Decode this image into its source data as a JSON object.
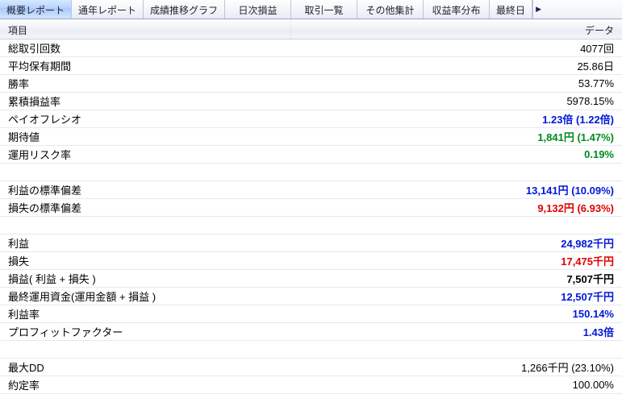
{
  "tabs": {
    "items": [
      "概要レポート",
      "通年レポート",
      "成績推移グラフ",
      "日次損益",
      "取引一覧",
      "その他集計",
      "収益率分布",
      "最終日"
    ],
    "active_index": 0
  },
  "header": {
    "left": "項目",
    "right": "データ"
  },
  "rows": [
    {
      "label": "総取引回数",
      "value": "4077回",
      "cls": ""
    },
    {
      "label": "平均保有期間",
      "value": "25.86日",
      "cls": ""
    },
    {
      "label": "勝率",
      "value": "53.77%",
      "cls": ""
    },
    {
      "label": "累積損益率",
      "value": "5978.15%",
      "cls": ""
    },
    {
      "label": "ペイオフレシオ",
      "value": "1.23倍 (1.22倍)",
      "cls": "blue"
    },
    {
      "label": "期待値",
      "value": "1,841円 (1.47%)",
      "cls": "green"
    },
    {
      "label": "運用リスク率",
      "value": "0.19%",
      "cls": "green"
    },
    {
      "spacer": true
    },
    {
      "label": "利益の標準偏差",
      "value": "13,141円 (10.09%)",
      "cls": "blue"
    },
    {
      "label": "損失の標準偏差",
      "value": "9,132円 (6.93%)",
      "cls": "red"
    },
    {
      "spacer": true
    },
    {
      "label": "利益",
      "value": "24,982千円",
      "cls": "blue"
    },
    {
      "label": "損失",
      "value": "17,475千円",
      "cls": "red"
    },
    {
      "label": "損益( 利益 + 損失 )",
      "value": "7,507千円",
      "cls": "blackb"
    },
    {
      "label": "最終運用資金(運用金額 + 損益 )",
      "value": "12,507千円",
      "cls": "blue"
    },
    {
      "label": "利益率",
      "value": "150.14%",
      "cls": "blue"
    },
    {
      "label": "プロフィットファクター",
      "value": "1.43倍",
      "cls": "blue"
    },
    {
      "spacer": true
    },
    {
      "label": "最大DD",
      "value": "1,266千円 (23.10%)",
      "cls": ""
    },
    {
      "label": "約定率",
      "value": "100.00%",
      "cls": ""
    }
  ]
}
